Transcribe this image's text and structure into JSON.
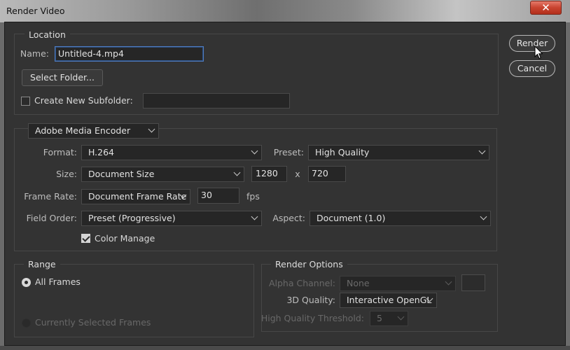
{
  "window": {
    "title": "Render Video",
    "close_glyph": "✕"
  },
  "location": {
    "legend": "Location",
    "name_label": "Name:",
    "name_value": "Untitled-4.mp4",
    "select_folder": "Select Folder...",
    "subfolder_label": "Create New Subfolder:",
    "subfolder_checked": false,
    "subfolder_value": ""
  },
  "encoder": {
    "selector": "Adobe Media Encoder",
    "format_label": "Format:",
    "format_value": "H.264",
    "preset_label": "Preset:",
    "preset_value": "High Quality",
    "size_label": "Size:",
    "size_value": "Document Size",
    "width": "1280",
    "x_sep": "x",
    "height": "720",
    "frame_rate_label": "Frame Rate:",
    "frame_rate_value": "Document Frame Rate",
    "fps_value": "30",
    "fps_unit": "fps",
    "field_order_label": "Field Order:",
    "field_order_value": "Preset (Progressive)",
    "aspect_label": "Aspect:",
    "aspect_value": "Document (1.0)",
    "color_manage_label": "Color Manage",
    "color_manage_checked": true
  },
  "range": {
    "legend": "Range",
    "all_frames": "All Frames",
    "selected_frames": "Currently Selected Frames"
  },
  "render_options": {
    "legend": "Render Options",
    "alpha_label": "Alpha Channel:",
    "alpha_value": "None",
    "quality_3d_label": "3D Quality:",
    "quality_3d_value": "Interactive OpenGL",
    "hq_threshold_label": "High Quality Threshold:",
    "hq_threshold_value": "5"
  },
  "actions": {
    "render": "Render",
    "cancel": "Cancel"
  },
  "colors": {
    "background": "#333333",
    "focus": "#4f7cc0",
    "close": "#c8432f"
  }
}
